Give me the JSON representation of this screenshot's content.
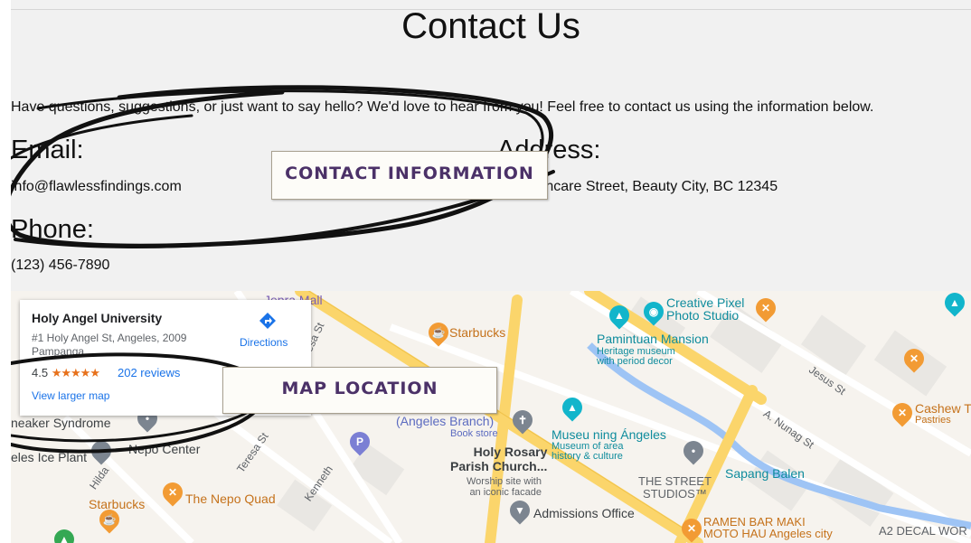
{
  "page": {
    "title": "Contact Us",
    "intro": "Have questions, suggestions, or just want to say hello? We'd love to hear from you! Feel free to contact us using the information below.",
    "email_heading": "Email:",
    "email_value": "info@flawlessfindings.com",
    "address_heading": "Address:",
    "address_value": "123 Skincare Street, Beauty City, BC 12345",
    "phone_heading": "Phone:",
    "phone_value": "(123) 456-7890"
  },
  "annotations": {
    "contact_info": "CONTACT INFORMATION",
    "map_location": "MAP LOCATION"
  },
  "map": {
    "card": {
      "place_name": "Holy Angel University",
      "address": "#1 Holy Angel St, Angeles, 2009 Pampanga",
      "rating": "4.5",
      "stars": "★★★★★",
      "reviews": "202 reviews",
      "view_larger": "View larger map",
      "directions": "Directions"
    },
    "labels": {
      "starbucks_top": "Starbucks",
      "creative_pixel": "Creative Pixel\nPhoto Studio",
      "pamintuan": "Pamintuan Mansion",
      "pamintuan_sub": "Heritage museum\nwith period decor",
      "jesus_st": "Jesus St",
      "cashew": "Cashew T",
      "pastries": "Pastries",
      "nunag_st": "A. Nunag St",
      "sneaker": "neaker Syndrome",
      "nepo_center": "Nepo Center",
      "ice_plant": "eles Ice Plant",
      "hilda": "Hilda",
      "teresa_st": "Teresa St",
      "teresa_st_top": "resa St",
      "kenneth": "Kenneth",
      "angeles_branch": "(Angeles Branch)",
      "book_store": "Book store",
      "holy_rosary": "Holy Rosary\nParish Church...",
      "worship": "Worship site with\nan iconic facade",
      "museu": "Museu ning Ángeles",
      "museu_sub": "Museum of area\nhistory & culture",
      "street_studios": "THE STREET\nSTUDIOS™",
      "sapang_balen": "Sapang Balen",
      "starbucks_bottom": "Starbucks",
      "nepo_quad": "The Nepo Quad",
      "admissions": "Admissions Office",
      "ramen": "RAMEN BAR MAKI\nMOTO HAU Angeles city",
      "a2decal": "A2 DECAL WOR",
      "nepa_mall": "Jepra Mall",
      "mall": "all"
    },
    "colors": {
      "road_major": "#fbd56b",
      "road_minor": "#ffffff",
      "water": "#9ec4f5",
      "block": "#e9e7e3",
      "food_pin": "#f29b34",
      "teal_pin": "#12b5cb",
      "gray_pin": "#7c8590",
      "brand_text": "#4b3168"
    }
  }
}
